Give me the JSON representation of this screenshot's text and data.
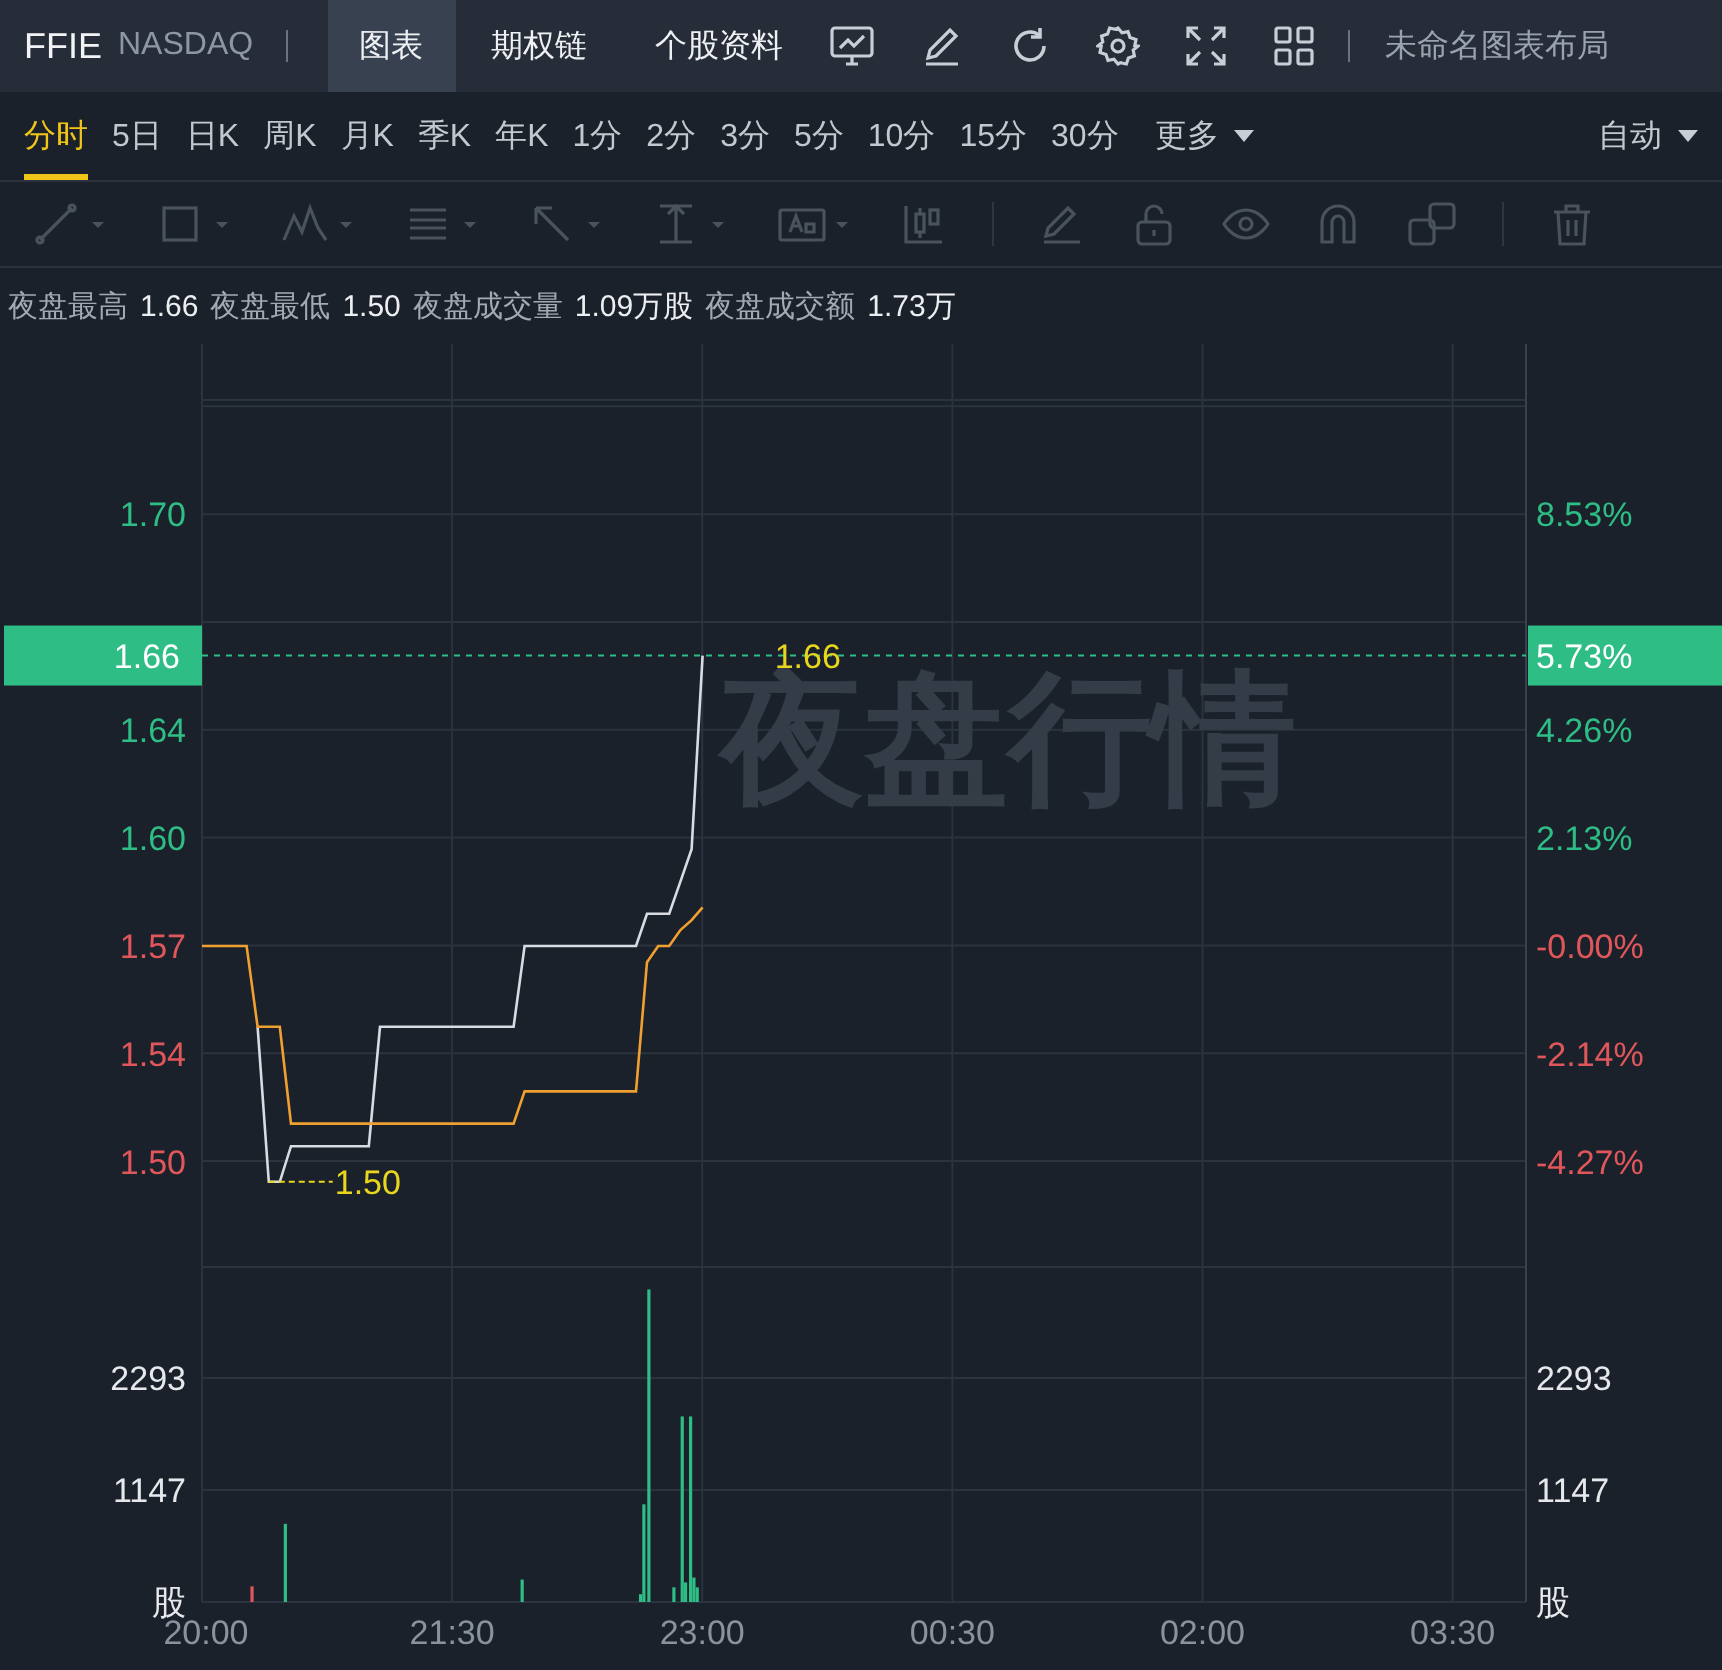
{
  "header": {
    "symbol": "FFIE",
    "exchange": "NASDAQ",
    "tabs": [
      {
        "label": "图表",
        "selected": true
      },
      {
        "label": "期权链",
        "selected": false
      },
      {
        "label": "个股资料",
        "selected": false
      }
    ],
    "layout_name": "未命名图表布局"
  },
  "periods": [
    {
      "label": "分时",
      "selected": true
    },
    {
      "label": "5日",
      "selected": false
    },
    {
      "label": "日K",
      "selected": false
    },
    {
      "label": "周K",
      "selected": false
    },
    {
      "label": "月K",
      "selected": false
    },
    {
      "label": "季K",
      "selected": false
    },
    {
      "label": "年K",
      "selected": false
    },
    {
      "label": "1分",
      "selected": false
    },
    {
      "label": "2分",
      "selected": false
    },
    {
      "label": "3分",
      "selected": false
    },
    {
      "label": "5分",
      "selected": false
    },
    {
      "label": "10分",
      "selected": false
    },
    {
      "label": "15分",
      "selected": false
    },
    {
      "label": "30分",
      "selected": false
    }
  ],
  "more_menu": "更多",
  "scale_menu": "自动",
  "stats": [
    {
      "label": "夜盘最高",
      "value": "1.66"
    },
    {
      "label": "夜盘最低",
      "value": "1.50"
    },
    {
      "label": "夜盘成交量",
      "value": "1.09万股"
    },
    {
      "label": "夜盘成交额",
      "value": "1.73万"
    }
  ],
  "price_chart": {
    "watermark": "夜盘行情",
    "current_price": "1.66",
    "current_change": "5.73%",
    "percent_labels": [
      {
        "label": "8.53%",
        "color": "#2ebd85"
      },
      {
        "label": "4.26%",
        "color": "#2ebd85"
      },
      {
        "label": "2.13%",
        "color": "#2ebd85"
      },
      {
        "label": "-0.00%",
        "color": "#e0575b"
      },
      {
        "label": "-2.14%",
        "color": "#e0575b"
      },
      {
        "label": "-4.27%",
        "color": "#e0575b"
      }
    ],
    "chart_data": {
      "type": "line",
      "grid": true,
      "categories": [
        null,
        null,
        null,
        null,
        null,
        null,
        null,
        null,
        null,
        null,
        null,
        null,
        null,
        null,
        null,
        null,
        null,
        null,
        null,
        null,
        null,
        null,
        null,
        null,
        null,
        null,
        null,
        null,
        null,
        null,
        null,
        null,
        null,
        null,
        null,
        null,
        null,
        null,
        null,
        null,
        null,
        null,
        null,
        null,
        null,
        null,
        null,
        null,
        null,
        null,
        null,
        null,
        null,
        null,
        null,
        null,
        null,
        null,
        null,
        null,
        null,
        null,
        null,
        null,
        null,
        null,
        null,
        null,
        null,
        null,
        null,
        null,
        null,
        null,
        null,
        null,
        null,
        null,
        null,
        null,
        null,
        null,
        null,
        null,
        null,
        null,
        null,
        null,
        null,
        null,
        null,
        null,
        null,
        null,
        null,
        null,
        null,
        null,
        null,
        null,
        null,
        null,
        null,
        null,
        null,
        null,
        null,
        null,
        null,
        null,
        null,
        null,
        null,
        null,
        null,
        null,
        null,
        null,
        null,
        null
      ],
      "series": [
        {
          "color": "#d8dce2",
          "values": [
            null,
            null,
            null,
            null,
            null,
            1.545,
            1.497,
            1.497,
            1.508,
            1.508,
            1.508,
            1.508,
            1.508,
            1.508,
            1.508,
            1.508,
            1.545,
            1.545,
            1.545,
            1.545,
            1.545,
            1.545,
            1.545,
            1.545,
            1.545,
            1.545,
            1.545,
            1.545,
            1.545,
            1.57,
            1.57,
            1.57,
            1.57,
            1.57,
            1.57,
            1.57,
            1.57,
            1.57,
            1.57,
            1.57,
            1.58,
            1.58,
            1.58,
            1.59,
            1.6,
            1.66,
            null,
            null,
            null,
            null,
            null,
            null,
            null,
            null,
            null,
            null,
            null,
            null,
            null,
            null,
            null,
            null,
            null,
            null,
            null,
            null,
            null,
            null,
            null,
            null,
            null,
            null,
            null,
            null,
            null,
            null,
            null,
            null,
            null,
            null,
            null,
            null,
            null,
            null,
            null,
            null,
            null,
            null,
            null,
            null,
            null,
            null,
            null,
            null,
            null,
            null,
            null,
            null,
            null,
            null,
            null,
            null,
            null,
            null,
            null,
            null,
            null,
            null,
            null,
            null,
            null,
            null,
            null,
            null,
            null,
            null,
            null,
            null,
            null,
            null
          ]
        },
        {
          "color": "#f0a030",
          "values": [
            1.57,
            1.57,
            1.57,
            1.57,
            1.57,
            1.545,
            1.545,
            1.545,
            1.515,
            1.515,
            1.515,
            1.515,
            1.515,
            1.515,
            1.515,
            1.515,
            1.515,
            1.515,
            1.515,
            1.515,
            1.515,
            1.515,
            1.515,
            1.515,
            1.515,
            1.515,
            1.515,
            1.515,
            1.515,
            1.525,
            1.525,
            1.525,
            1.525,
            1.525,
            1.525,
            1.525,
            1.525,
            1.525,
            1.525,
            1.525,
            1.565,
            1.57,
            1.57,
            1.575,
            1.578,
            1.582,
            null,
            null,
            null,
            null,
            null,
            null,
            null,
            null,
            null,
            null,
            null,
            null,
            null,
            null,
            null,
            null,
            null,
            null,
            null,
            null,
            null,
            null,
            null,
            null,
            null,
            null,
            null,
            null,
            null,
            null,
            null,
            null,
            null,
            null,
            null,
            null,
            null,
            null,
            null,
            null,
            null,
            null,
            null,
            null,
            null,
            null,
            null,
            null,
            null,
            null,
            null,
            null,
            null,
            null,
            null,
            null,
            null,
            null,
            null,
            null,
            null,
            null,
            null,
            null,
            null,
            null,
            null,
            null,
            null,
            null,
            null,
            null,
            null,
            null
          ]
        }
      ],
      "ylim": [
        1.4709,
        1.7565
      ],
      "ref_lines": [
        {
          "axis": "y",
          "value": 1.66,
          "color": "#2ebd85"
        }
      ],
      "yticks": [
        {
          "value": 1.7038,
          "label": "1.70"
        },
        {
          "value": 1.6369,
          "label": "1.64"
        },
        {
          "value": 1.6035,
          "label": "1.60"
        },
        {
          "value": 1.57,
          "label": "1.57"
        },
        {
          "value": 1.5366,
          "label": "1.54"
        },
        {
          "value": 1.503,
          "label": "1.50"
        }
      ],
      "annotations": [
        "1.66",
        "1.50"
      ]
    }
  },
  "volume_chart": {
    "right_labels": [
      "2293",
      "1147",
      "股"
    ],
    "next_day_labels": [
      "00:30",
      "02:00",
      "03:30"
    ],
    "chart_data": {
      "type": "bar",
      "grid": true,
      "x": [
        20.3,
        20.5,
        21.92,
        22.63,
        22.65,
        22.68,
        22.83,
        22.88,
        22.9,
        22.93,
        22.95,
        22.97
      ],
      "series": [
        {
          "color": "#e0575b",
          "values": [
            160,
            null,
            null,
            null,
            null,
            null,
            null,
            null,
            null,
            null,
            null,
            null
          ]
        },
        {
          "color": "#2ebd85",
          "values": [
            null,
            800,
            230,
            80,
            1000,
            3200,
            150,
            1900,
            200,
            1900,
            250,
            150
          ]
        }
      ],
      "xlim": [
        20,
        27.94
      ],
      "ylim": [
        0,
        3440
      ],
      "yticks": [
        {
          "value": 2293,
          "label": "2293"
        },
        {
          "value": 1147,
          "label": "1147"
        },
        {
          "value": 0,
          "label": "股"
        }
      ],
      "xticks": [
        {
          "value": 20,
          "label": "20:00"
        },
        {
          "value": 21.5,
          "label": "21:30"
        },
        {
          "value": 23,
          "label": "23:00"
        }
      ]
    }
  }
}
